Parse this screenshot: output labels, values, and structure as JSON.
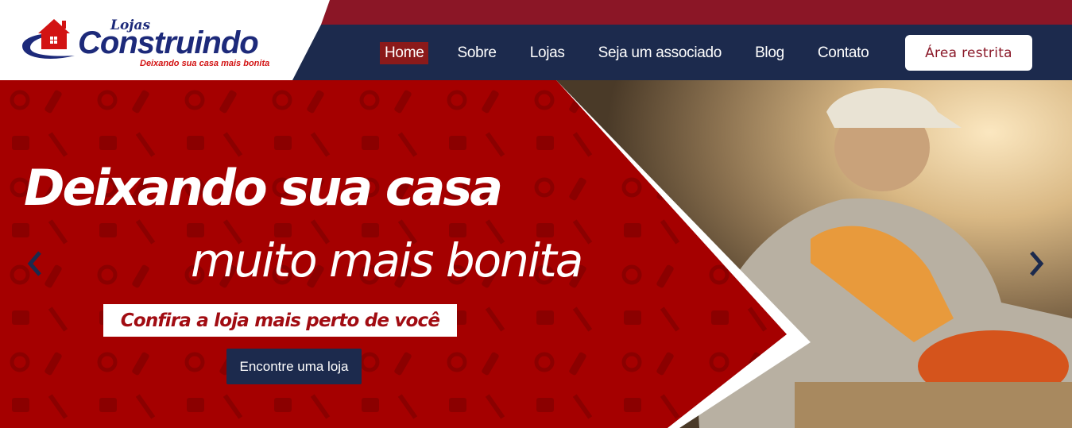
{
  "brand": {
    "prefix": "Lojas",
    "name": "Construindo",
    "tagline": "Deixando sua casa mais bonita"
  },
  "nav": {
    "items": [
      {
        "label": "Home",
        "active": true
      },
      {
        "label": "Sobre",
        "active": false
      },
      {
        "label": "Lojas",
        "active": false
      },
      {
        "label": "Seja um associado",
        "active": false
      },
      {
        "label": "Blog",
        "active": false
      },
      {
        "label": "Contato",
        "active": false
      }
    ],
    "restricted_label": "Área restrita"
  },
  "hero": {
    "headline_line1": "Deixando sua casa",
    "headline_line2": "muito mais bonita",
    "subheadline": "Confira a loja mais perto de você",
    "cta_label": "Encontre uma loja",
    "prev_icon": "chevron-left-icon",
    "next_icon": "chevron-right-icon"
  },
  "colors": {
    "header_navy": "#1c2a4d",
    "header_red_strip": "#8b1626",
    "hero_red": "#a50000",
    "active_nav": "#8b1a1a",
    "logo_blue": "#1d2a7a",
    "logo_red": "#d21313"
  }
}
